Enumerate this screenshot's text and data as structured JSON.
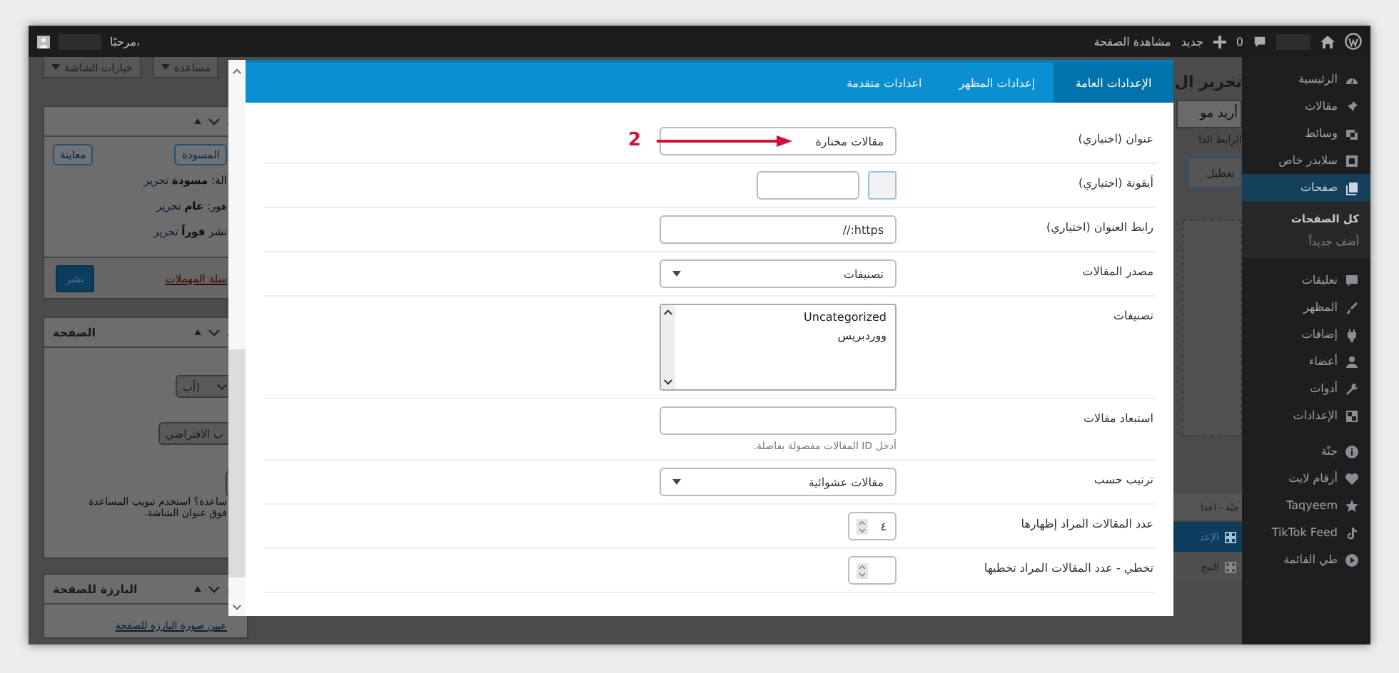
{
  "admin_bar": {
    "view_page": "مشاهدة الصفحة",
    "new_label": "جديد",
    "comments_count": "0",
    "greeting": "مرحبًا،"
  },
  "sidebar": {
    "items": [
      {
        "label": "الرئيسية",
        "selected": false
      },
      {
        "label": "مقالات",
        "selected": false
      },
      {
        "label": "وسائط",
        "selected": false
      },
      {
        "label": "سلايدر خاص",
        "selected": false
      },
      {
        "label": "صفحات",
        "selected": true,
        "children": [
          {
            "label": "كل الصفحات",
            "selected": true
          },
          {
            "label": "أضف جديداً",
            "selected": false
          }
        ]
      },
      {
        "label": "تعليقات",
        "selected": false
      },
      {
        "label": "المظهر",
        "selected": false
      },
      {
        "label": "إضافات",
        "selected": false
      },
      {
        "label": "أعضاء",
        "selected": false
      },
      {
        "label": "أدوات",
        "selected": false
      },
      {
        "label": "الإعدادات",
        "selected": false
      },
      {
        "label": "جنّة",
        "selected": false
      },
      {
        "label": "أرقام لايت",
        "selected": false
      },
      {
        "label": "Taqyeem",
        "selected": false
      },
      {
        "label": "TikTok Feed",
        "selected": false
      },
      {
        "label": "طي القائمة",
        "selected": false
      }
    ]
  },
  "screen_tabs": [
    {
      "label": "مساعدة"
    },
    {
      "label": "خيارات الشاشة"
    }
  ],
  "publish_box": {
    "preview": "معاينة",
    "save_draft": "المسودة",
    "status_lines": [
      {
        "label": "الة:",
        "value": "مسودة",
        "link": "تحرير"
      },
      {
        "label": "هور:",
        "value": "عام",
        "link": "تحرير"
      },
      {
        "label": "نشر",
        "value": "فوراً",
        "link": "تحرير"
      }
    ],
    "trash": "سلة المهملات",
    "publish": "نشر"
  },
  "attributes_box": {
    "title": "الصفحة",
    "parent_select": "أب)",
    "template_select": "ب الافتراضي",
    "help_lines": [
      "ساعدة؟ استخدم تبويب المساعدة",
      "فوق عنوان الشاشة."
    ]
  },
  "featured_box": {
    "title": "البارزة للصفحة",
    "link": "عيين صورة البارزة للصفحة"
  },
  "editor_strip": {
    "title": "تحرير ال",
    "title_input": "أريد مو",
    "permalink": "الرابط الدا",
    "disable_button": "تعطيل",
    "panel_title": "جنّة - اعدا",
    "items": [
      {
        "label": "الإعد",
        "selected": true
      },
      {
        "label": "المح",
        "selected": false
      }
    ]
  },
  "modal": {
    "tabs": [
      {
        "label": "الإعدادات العامة",
        "selected": true
      },
      {
        "label": "إعدادات المظهر",
        "selected": false
      },
      {
        "label": "اعدادات متقدمة",
        "selected": false
      }
    ],
    "fields": [
      {
        "kind": "text",
        "label": "عنوان (اختياري)",
        "value": "مقالات مختارة"
      },
      {
        "kind": "icon",
        "label": "أيقونة (اختياري)"
      },
      {
        "kind": "text",
        "label": "رابط العنوان (اختياري)",
        "value": "https://"
      },
      {
        "kind": "select",
        "label": "مصدر المقالات",
        "value": "تصنيفات"
      },
      {
        "kind": "multiselect",
        "label": "تصنيفات",
        "options": [
          {
            "label": "Uncategorized",
            "selected": false
          },
          {
            "label": "ووردبريس",
            "selected": false
          }
        ]
      },
      {
        "kind": "text",
        "label": "استبعاد مقالات",
        "hint": "أدخل ID المقالات مفصولة بفاصلة."
      },
      {
        "kind": "select",
        "label": "ترتيب حسب",
        "value": "مقالات عشوائية"
      },
      {
        "kind": "number",
        "label": "عدد المقالات المراد إظهارها",
        "value": "٤"
      },
      {
        "kind": "number",
        "label": "تخطي - عدد المقالات المراد تخطيها"
      }
    ]
  },
  "annotation": {
    "label": "2"
  }
}
